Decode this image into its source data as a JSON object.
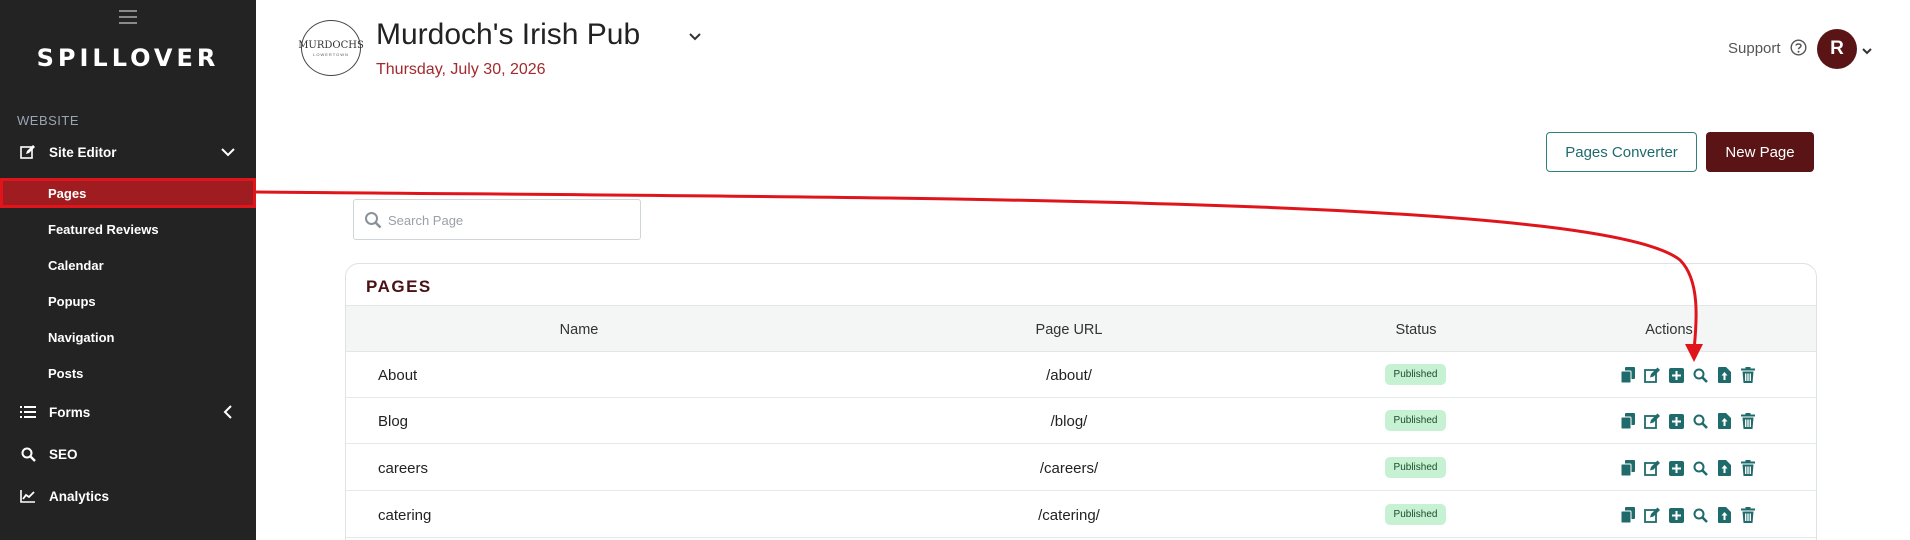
{
  "sidebar": {
    "logo": "SPILLOVER",
    "section_label": "WEBSITE",
    "site_editor": {
      "label": "Site Editor",
      "icon": "edit-icon"
    },
    "sub_items": [
      {
        "label": "Pages",
        "active": true
      },
      {
        "label": "Featured Reviews",
        "active": false
      },
      {
        "label": "Calendar",
        "active": false
      },
      {
        "label": "Popups",
        "active": false
      },
      {
        "label": "Navigation",
        "active": false
      },
      {
        "label": "Posts",
        "active": false
      }
    ],
    "forms": {
      "label": "Forms",
      "icon": "list-icon"
    },
    "seo": {
      "label": "SEO",
      "icon": "search-icon"
    },
    "analytics": {
      "label": "Analytics",
      "icon": "chart-line-icon"
    }
  },
  "header": {
    "logo_text": "MURDOCHS",
    "logo_subtext": "LOWERTOWN",
    "title": "Murdoch's Irish Pub",
    "date": "Thursday, July 30, 2026",
    "support_label": "Support",
    "avatar_initial": "R"
  },
  "toolbar": {
    "converter_label": "Pages Converter",
    "new_page_label": "New Page"
  },
  "search": {
    "placeholder": "Search Page"
  },
  "table": {
    "title": "PAGES",
    "columns": [
      "Name",
      "Page URL",
      "Status",
      "Actions"
    ],
    "rows": [
      {
        "name": "About",
        "url": "/about/",
        "status": "Published"
      },
      {
        "name": "Blog",
        "url": "/blog/",
        "status": "Published"
      },
      {
        "name": "careers",
        "url": "/careers/",
        "status": "Published"
      },
      {
        "name": "catering",
        "url": "/catering/",
        "status": "Published"
      }
    ],
    "action_icons": [
      "copy-icon",
      "edit-icon",
      "add-icon",
      "preview-icon",
      "export-icon",
      "delete-icon"
    ]
  },
  "colors": {
    "sidebar_bg": "#232323",
    "active_item": "#9f1d20",
    "brand": "#5a1416",
    "teal": "#1f6b6c",
    "badge_bg": "#c6f1d2",
    "annotation": "#e0141b"
  }
}
